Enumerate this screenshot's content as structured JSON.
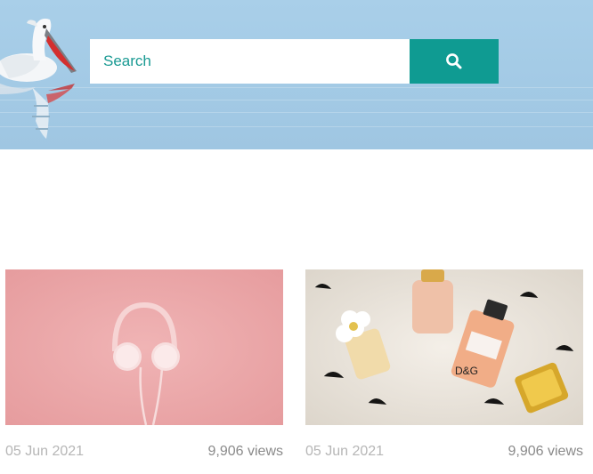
{
  "search": {
    "placeholder": "Search",
    "button_icon": "search-icon"
  },
  "colors": {
    "accent": "#0f9b92",
    "hero_sky": "#a4cbe6",
    "meta_text": "#8a8a8a"
  },
  "posts": [
    {
      "image": "headphones-on-pink-background",
      "date": "05 Jun 2021",
      "views": "9,906 views"
    },
    {
      "image": "perfume-bottles-on-white-fur",
      "date": "05 Jun 2021",
      "views": "9,906 views"
    }
  ]
}
